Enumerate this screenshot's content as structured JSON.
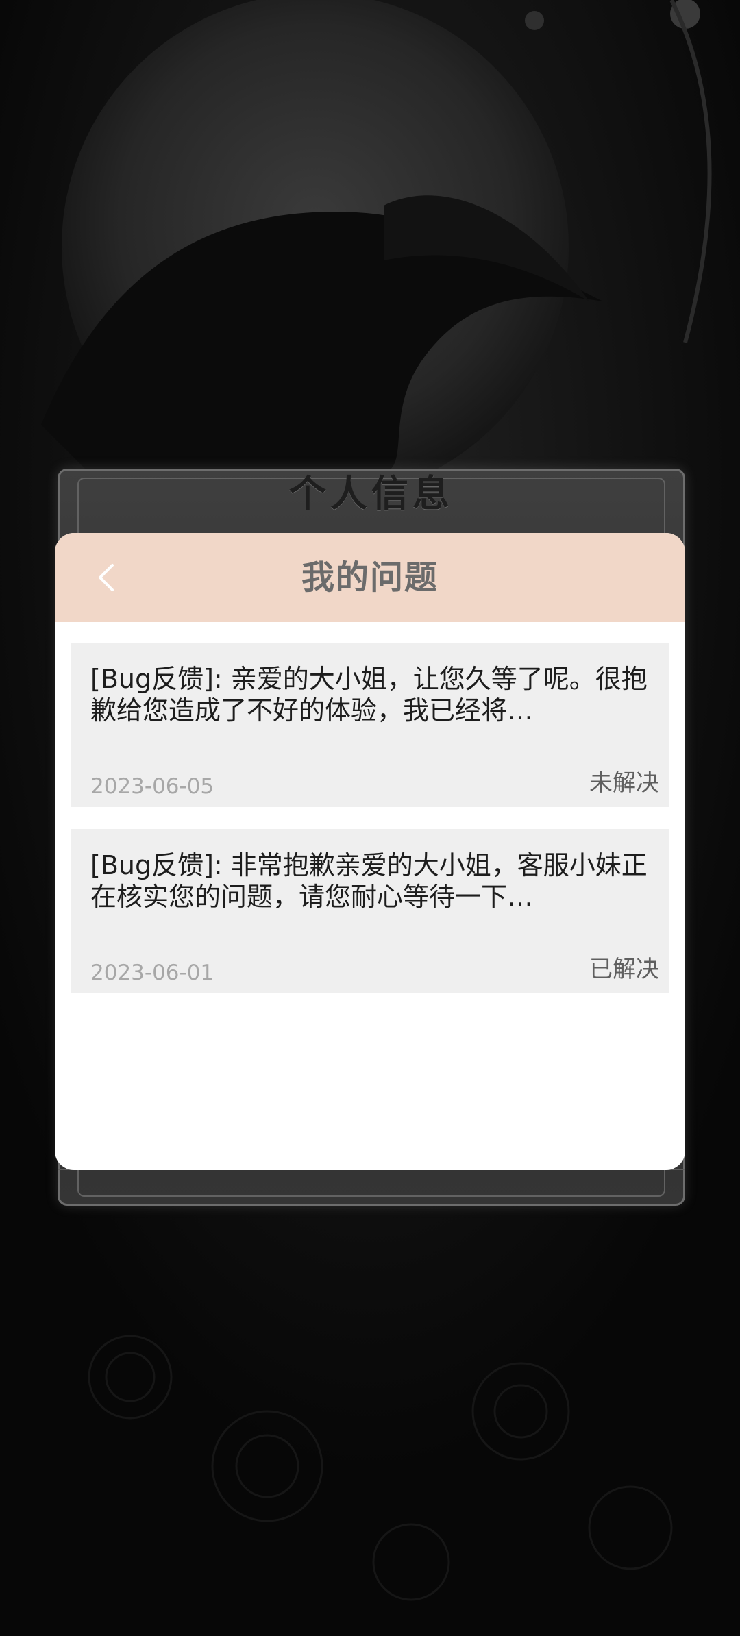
{
  "panel": {
    "title": "个人信息"
  },
  "header": {
    "title": "我的问题"
  },
  "issues": [
    {
      "text": "[Bug反馈]: 亲爱的大小姐，让您久等了呢。很抱歉给您造成了不好的体验，我已经将…",
      "date": "2023-06-05",
      "status": "未解决"
    },
    {
      "text": "[Bug反馈]: 非常抱歉亲爱的大小姐，客服小妹正在核实您的问题，请您耐心等待一下…",
      "date": "2023-06-01",
      "status": "已解决"
    }
  ],
  "colors": {
    "header_bg": "#f1d7c8",
    "card_bg": "#ffffff",
    "item_bg": "#efefef",
    "page_bg": "#070707"
  },
  "icons": {
    "back": "chevron-left-icon"
  }
}
